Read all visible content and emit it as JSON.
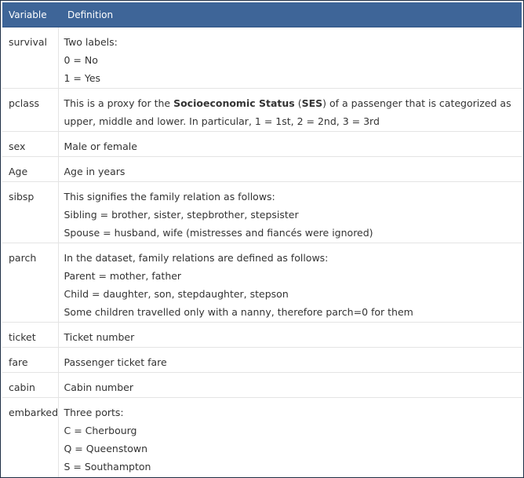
{
  "header": {
    "variable": "Variable",
    "definition": "Definition"
  },
  "rows": [
    {
      "variable": "survival",
      "lines": [
        "Two labels:",
        "0 = No",
        "1 = Yes"
      ]
    },
    {
      "variable": "pclass",
      "pclass_parts": {
        "a": "This is a proxy for the ",
        "b": "Socioeconomic Status",
        "c": " (",
        "d": "SES",
        "e": ") of a passenger that is categorized as upper, middle and lower. In particular, 1 = 1st, 2 = 2nd, 3 = 3rd"
      }
    },
    {
      "variable": "sex",
      "lines": [
        "Male or female"
      ]
    },
    {
      "variable": "Age",
      "lines": [
        "Age in years"
      ]
    },
    {
      "variable": "sibsp",
      "lines": [
        "This signifies the family relation as follows:",
        "Sibling = brother, sister, stepbrother, stepsister",
        "Spouse = husband, wife (mistresses and fiancés were ignored)"
      ]
    },
    {
      "variable": "parch",
      "lines": [
        "In the dataset, family relations are defined as follows:",
        "Parent = mother, father",
        "Child = daughter, son, stepdaughter, stepson",
        "Some children travelled only with a nanny, therefore parch=0 for them"
      ]
    },
    {
      "variable": "ticket",
      "lines": [
        "Ticket number"
      ]
    },
    {
      "variable": "fare",
      "lines": [
        "Passenger ticket fare"
      ]
    },
    {
      "variable": "cabin",
      "lines": [
        "Cabin number"
      ]
    },
    {
      "variable": "embarked",
      "lines": [
        "Three ports:",
        "C = Cherbourg",
        "Q = Queenstown",
        "S = Southampton"
      ]
    }
  ]
}
